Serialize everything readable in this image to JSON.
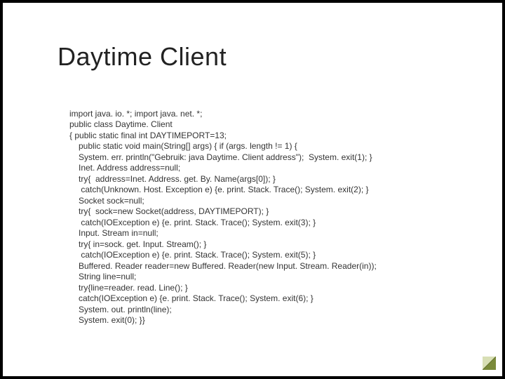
{
  "title": "Daytime Client",
  "code": {
    "l1": "import java. io. *; import java. net. *;",
    "l2": "public class Daytime. Client",
    "l3": "{ public static final int DAYTIMEPORT=13;",
    "l4": "public static void main(String[] args) { if (args. length != 1) {",
    "l5": "System. err. println(\"Gebruik: java Daytime. Client address\");  System. exit(1); }",
    "l6": "Inet. Address address=null;",
    "l7": "try{  address=Inet. Address. get. By. Name(args[0]); }",
    "l8": " catch(Unknown. Host. Exception e) {e. print. Stack. Trace(); System. exit(2); }",
    "l9": "Socket sock=null;",
    "l10": "try{  sock=new Socket(address, DAYTIMEPORT); }",
    "l11": " catch(IOException e) {e. print. Stack. Trace(); System. exit(3); }",
    "l12": "Input. Stream in=null;",
    "l13": "try{ in=sock. get. Input. Stream(); }",
    "l14": " catch(IOException e) {e. print. Stack. Trace(); System. exit(5); }",
    "l15": "Buffered. Reader reader=new Buffered. Reader(new Input. Stream. Reader(in));",
    "l16": "String line=null;",
    "l17": "try{line=reader. read. Line(); }",
    "l18": "catch(IOException e) {e. print. Stack. Trace(); System. exit(6); }",
    "l19": "System. out. println(line);",
    "l20": "System. exit(0); }}"
  }
}
